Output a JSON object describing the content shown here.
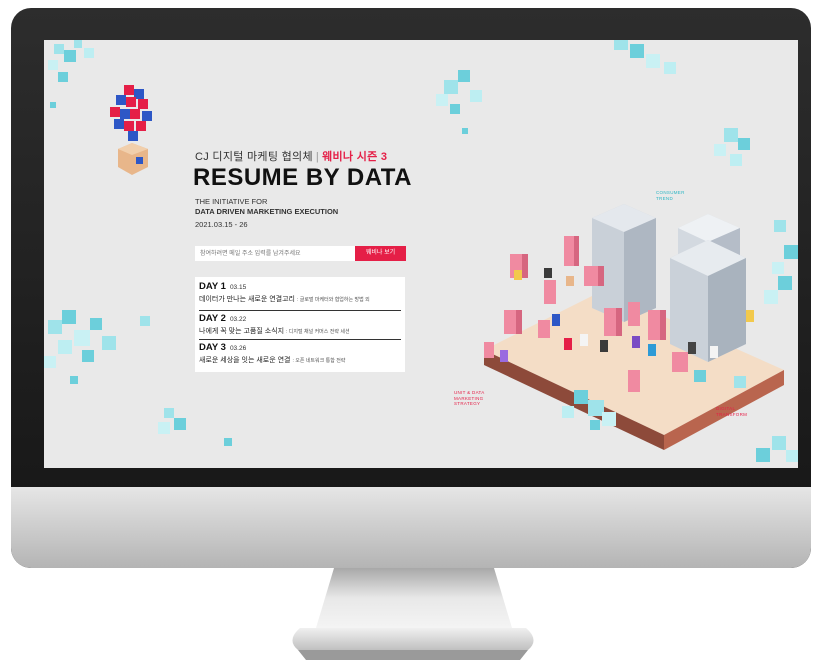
{
  "page": {
    "subtitle_org": "CJ 디지털 마케팅 협의체",
    "subtitle_sep": "|",
    "subtitle_season": "웨비나 시즌 3",
    "title": "RESUME BY DATA",
    "tagline_line1": "THE INITIATIVE FOR",
    "tagline_line2": "DATA DRIVEN MARKETING EXECUTION",
    "dates": "2021.03.15 - 26"
  },
  "email": {
    "placeholder": "참여하려면 메일 주소 입력를 남겨주세요",
    "button_label": "웨비나 보기"
  },
  "days": [
    {
      "label": "DAY 1",
      "date": "03.15",
      "topic": "데이터가 만나는 새로운 연결고리",
      "speakers": ": 글로벌 마케터와 협업하는 방법 외"
    },
    {
      "label": "DAY 2",
      "date": "03.22",
      "topic": "나에게 꼭 맞는 고품질 소식지",
      "speakers": ": 디지털 채널 커머스 전략 세션"
    },
    {
      "label": "DAY 3",
      "date": "03.26",
      "topic": "새로운 세상을 잇는 새로운 연결",
      ": 오픈 네트워크 통합 전략": "",
      "speakers": ": 오픈 네트워크 통합 전략"
    }
  ],
  "labels": {
    "consumer": [
      "CONSUMER",
      "TREND"
    ],
    "marketing": [
      "UNIT & DATA",
      "MARKETING",
      "STRATEGY"
    ],
    "digital": [
      "DIGITAL",
      "TRANSFORM"
    ]
  },
  "colors": {
    "accent": "#e51f47",
    "cube_light": "#bfeef2",
    "cube_mid": "#7fd6e0",
    "cube_dark": "#36b5c6",
    "ground": "#f4ddc6",
    "building": "#cfd6de"
  },
  "icons": [
    "cube-logo-icon",
    "pixel-cube-cluster-icon",
    "isometric-city-illustration"
  ]
}
